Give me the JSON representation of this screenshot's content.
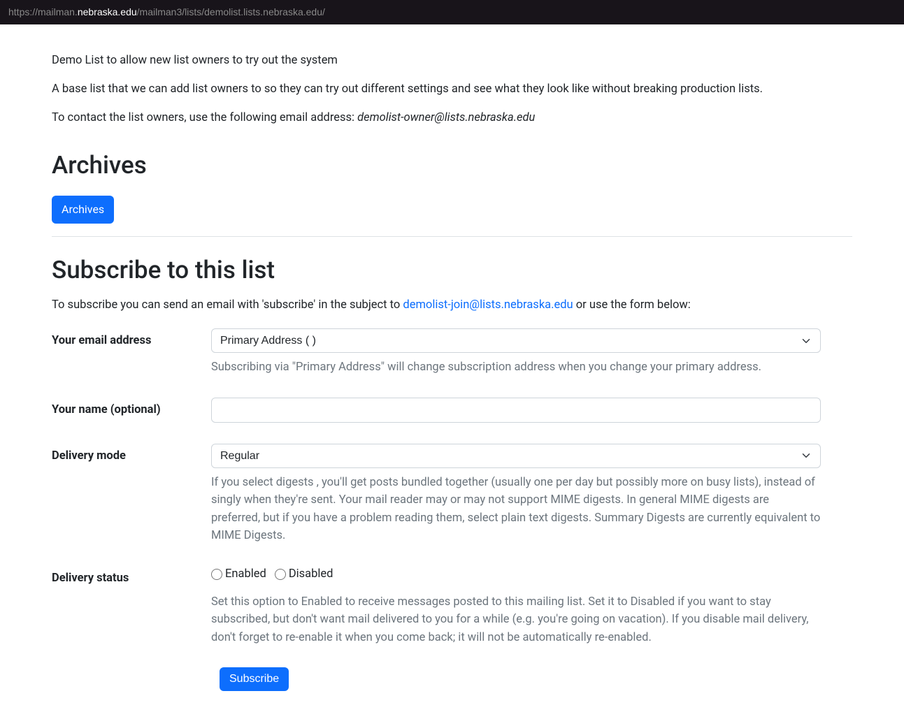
{
  "url": {
    "prefix": "https://mailman.",
    "highlight": "nebraska.edu",
    "suffix": "/mailman3/lists/demolist.lists.nebraska.edu/"
  },
  "intro": "Demo List to allow new list owners to try out the system",
  "description": "A base list that we can add list owners to so they can try out different settings and see what they look like without breaking production lists.",
  "contact": {
    "prefix": "To contact the list owners, use the following email address: ",
    "email": "demolist-owner@lists.nebraska.edu"
  },
  "archives": {
    "heading": "Archives",
    "button": "Archives"
  },
  "subscribe": {
    "heading": "Subscribe to this list",
    "intro_prefix": "To subscribe you can send an email with 'subscribe' in the subject to ",
    "intro_email": "demolist-join@lists.nebraska.edu",
    "intro_suffix": " or use the form below:",
    "email_label": "Your email address",
    "email_select_value": "Primary Address (                                       )",
    "email_help": "Subscribing via \"Primary Address\" will change subscription address when you change your primary address.",
    "name_label": "Your name (optional)",
    "delivery_mode_label": "Delivery mode",
    "delivery_mode_value": "Regular",
    "delivery_mode_help": "If you select digests , you'll get posts bundled together (usually one per day but possibly more on busy lists), instead of singly when they're sent. Your mail reader may or may not support MIME digests. In general MIME digests are preferred, but if you have a problem reading them, select plain text digests. Summary Digests are currently equivalent to MIME Digests.",
    "delivery_status_label": "Delivery status",
    "delivery_status_enabled": "Enabled",
    "delivery_status_disabled": "Disabled",
    "delivery_status_help": "Set this option to Enabled to receive messages posted to this mailing list. Set it to Disabled if you want to stay subscribed, but don't want mail delivered to you for a while (e.g. you're going on vacation). If you disable mail delivery, don't forget to re-enable it when you come back; it will not be automatically re-enabled.",
    "submit_button": "Subscribe"
  }
}
